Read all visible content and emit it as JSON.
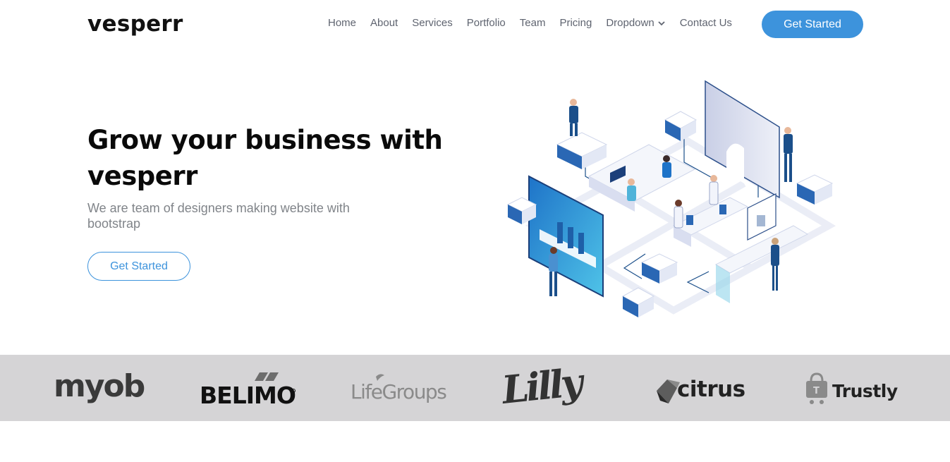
{
  "brand": {
    "name": "vesperr"
  },
  "nav": {
    "items": [
      {
        "label": "Home"
      },
      {
        "label": "About"
      },
      {
        "label": "Services"
      },
      {
        "label": "Portfolio"
      },
      {
        "label": "Team"
      },
      {
        "label": "Pricing"
      },
      {
        "label": "Dropdown",
        "icon": "chevron-down-icon"
      },
      {
        "label": "Contact Us"
      }
    ],
    "cta_label": "Get Started"
  },
  "hero": {
    "title": "Grow your business with vesperr",
    "subtitle": "We are team of designers making website with bootstrap",
    "button_label": "Get Started"
  },
  "clients": [
    {
      "name": "myob"
    },
    {
      "name": "BELIMO"
    },
    {
      "name": "LifeGroups"
    },
    {
      "name": "Lilly"
    },
    {
      "name": "citrus"
    },
    {
      "name": "Trustly"
    }
  ],
  "colors": {
    "accent": "#3d93dc",
    "clients_bg": "#d5d4d6",
    "nav_text": "#5f6470",
    "subtitle": "#808489"
  }
}
